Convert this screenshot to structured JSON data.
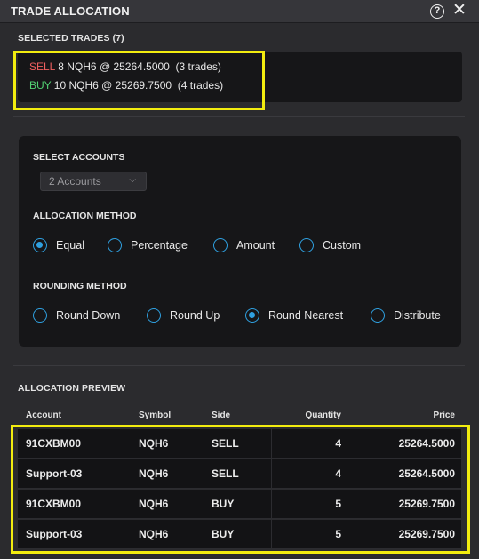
{
  "window": {
    "title": "TRADE ALLOCATION",
    "help_icon": "?",
    "close_icon": "✕"
  },
  "selected_trades": {
    "header": "SELECTED TRADES (7)",
    "lines": [
      {
        "side": "SELL",
        "detail": " 8 NQH6 @ 25264.5000  (3 trades)"
      },
      {
        "side": "BUY",
        "detail": " 10 NQH6 @ 25269.7500  (4 trades)"
      }
    ]
  },
  "settings": {
    "select_accounts_label": "SELECT ACCOUNTS",
    "accounts_value": "2 Accounts",
    "allocation_method_label": "ALLOCATION METHOD",
    "allocation_options": [
      "Equal",
      "Percentage",
      "Amount",
      "Custom"
    ],
    "allocation_selected": "Equal",
    "rounding_method_label": "ROUNDING METHOD",
    "rounding_options": [
      "Round Down",
      "Round Up",
      "Round Nearest",
      "Distribute"
    ],
    "rounding_selected": "Round Nearest"
  },
  "preview": {
    "header": "ALLOCATION PREVIEW",
    "columns": [
      "Account",
      "Symbol",
      "Side",
      "Quantity",
      "Price"
    ],
    "rows": [
      {
        "account": "91CXBM00",
        "symbol": "NQH6",
        "side": "SELL",
        "quantity": "4",
        "price": "25264.5000"
      },
      {
        "account": "Support-03",
        "symbol": "NQH6",
        "side": "SELL",
        "quantity": "4",
        "price": "25264.5000"
      },
      {
        "account": "91CXBM00",
        "symbol": "NQH6",
        "side": "BUY",
        "quantity": "5",
        "price": "25269.7500"
      },
      {
        "account": "Support-03",
        "symbol": "NQH6",
        "side": "BUY",
        "quantity": "5",
        "price": "25269.7500"
      }
    ]
  },
  "colors": {
    "sell": "#ef5f5f",
    "buy": "#52d273",
    "radio_accent": "#2fa0e0",
    "highlight": "#f2ec0f"
  }
}
